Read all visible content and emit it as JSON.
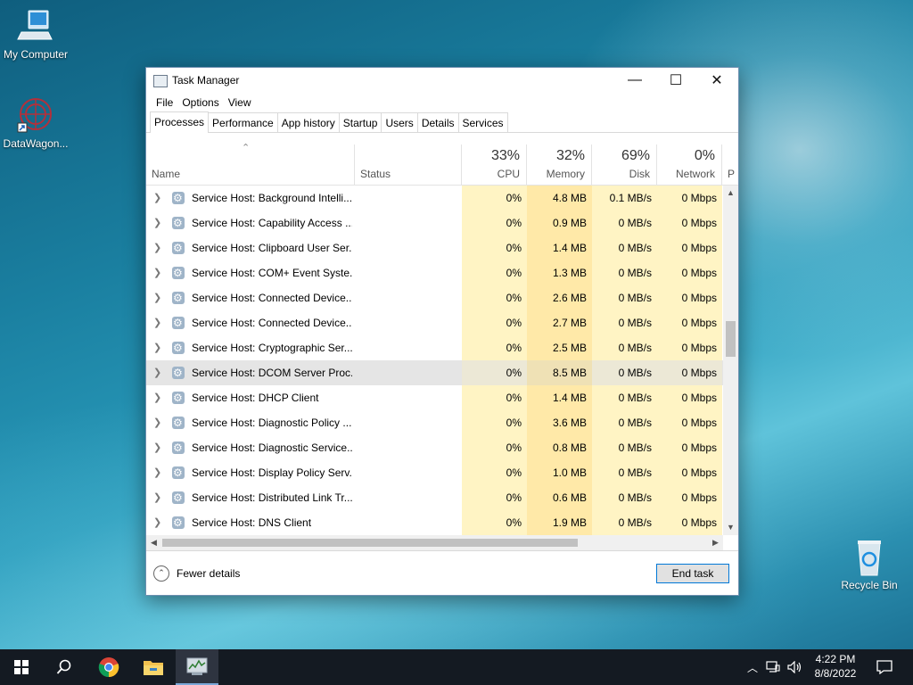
{
  "desktop": {
    "icons": [
      {
        "label": "My Computer"
      },
      {
        "label": "DataWagon..."
      },
      {
        "label": "Recycle Bin"
      }
    ]
  },
  "window": {
    "title": "Task Manager",
    "controls": {
      "minimize": "—",
      "maximize": "☐",
      "close": "✕"
    }
  },
  "menu": [
    "File",
    "Options",
    "View"
  ],
  "tabs": [
    "Processes",
    "Performance",
    "App history",
    "Startup",
    "Users",
    "Details",
    "Services"
  ],
  "active_tab": "Processes",
  "columns": {
    "name": "Name",
    "status": "Status",
    "cpu": {
      "pct": "33%",
      "label": "CPU"
    },
    "memory": {
      "pct": "32%",
      "label": "Memory"
    },
    "disk": {
      "pct": "69%",
      "label": "Disk"
    },
    "network": {
      "pct": "0%",
      "label": "Network"
    },
    "overflow": "P"
  },
  "processes": [
    {
      "name": "Service Host: Background Intelli...",
      "cpu": "0%",
      "memory": "4.8 MB",
      "disk": "0.1 MB/s",
      "network": "0 Mbps"
    },
    {
      "name": "Service Host: Capability Access ...",
      "cpu": "0%",
      "memory": "0.9 MB",
      "disk": "0 MB/s",
      "network": "0 Mbps"
    },
    {
      "name": "Service Host: Clipboard User Ser...",
      "cpu": "0%",
      "memory": "1.4 MB",
      "disk": "0 MB/s",
      "network": "0 Mbps"
    },
    {
      "name": "Service Host: COM+ Event Syste...",
      "cpu": "0%",
      "memory": "1.3 MB",
      "disk": "0 MB/s",
      "network": "0 Mbps"
    },
    {
      "name": "Service Host: Connected Device...",
      "cpu": "0%",
      "memory": "2.6 MB",
      "disk": "0 MB/s",
      "network": "0 Mbps"
    },
    {
      "name": "Service Host: Connected Device...",
      "cpu": "0%",
      "memory": "2.7 MB",
      "disk": "0 MB/s",
      "network": "0 Mbps"
    },
    {
      "name": "Service Host: Cryptographic Ser...",
      "cpu": "0%",
      "memory": "2.5 MB",
      "disk": "0 MB/s",
      "network": "0 Mbps"
    },
    {
      "name": "Service Host: DCOM Server Proc...",
      "cpu": "0%",
      "memory": "8.5 MB",
      "disk": "0 MB/s",
      "network": "0 Mbps"
    },
    {
      "name": "Service Host: DHCP Client",
      "cpu": "0%",
      "memory": "1.4 MB",
      "disk": "0 MB/s",
      "network": "0 Mbps"
    },
    {
      "name": "Service Host: Diagnostic Policy ...",
      "cpu": "0%",
      "memory": "3.6 MB",
      "disk": "0 MB/s",
      "network": "0 Mbps"
    },
    {
      "name": "Service Host: Diagnostic Service...",
      "cpu": "0%",
      "memory": "0.8 MB",
      "disk": "0 MB/s",
      "network": "0 Mbps"
    },
    {
      "name": "Service Host: Display Policy Serv...",
      "cpu": "0%",
      "memory": "1.0 MB",
      "disk": "0 MB/s",
      "network": "0 Mbps"
    },
    {
      "name": "Service Host: Distributed Link Tr...",
      "cpu": "0%",
      "memory": "0.6 MB",
      "disk": "0 MB/s",
      "network": "0 Mbps"
    },
    {
      "name": "Service Host: DNS Client",
      "cpu": "0%",
      "memory": "1.9 MB",
      "disk": "0 MB/s",
      "network": "0 Mbps"
    }
  ],
  "selected_row": 7,
  "footer": {
    "fewer_details": "Fewer details",
    "end_task": "End task"
  },
  "taskbar": {
    "time": "4:22 PM",
    "date": "8/8/2022",
    "icons": [
      "start-icon",
      "search-icon",
      "chrome-icon",
      "file-explorer-icon",
      "task-manager-icon"
    ]
  },
  "colors": {
    "accent": "#0078d7",
    "cpu_fill": "#fff4c4",
    "memory_fill": "#ffe9a8",
    "selected": "#e5e5e5",
    "taskbar": "#141a22"
  }
}
